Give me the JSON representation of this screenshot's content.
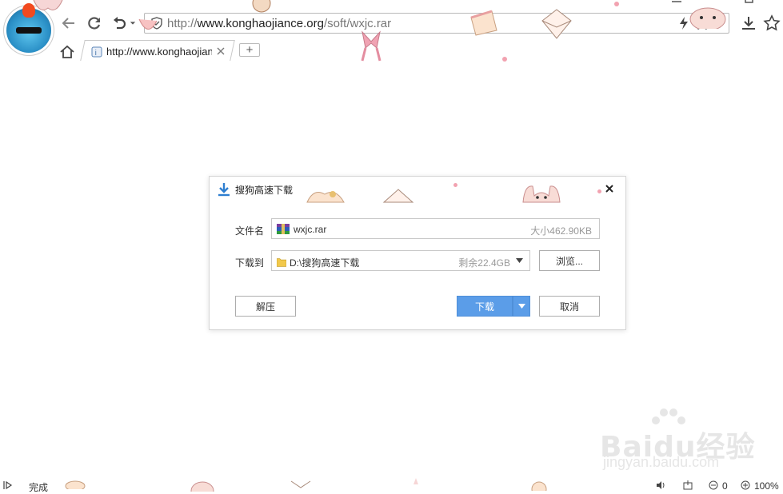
{
  "toolbar": {
    "url_prefix": "http://",
    "url_domain": "www.konghaojiance.org",
    "url_path": "/soft/wxjc.rar"
  },
  "tab": {
    "title": "http://www.konghaojiance.org/soft/wxjc.rar"
  },
  "new_tab_label": "+",
  "dialog": {
    "title": "搜狗高速下载",
    "filename_label": "文件名",
    "filename_value": "wxjc.rar",
    "filesize": "大小462.90KB",
    "saveto_label": "下载到",
    "saveto_value": "D:\\搜狗高速下载",
    "free_space": "剩余22.4GB",
    "browse_button": "浏览...",
    "extract_button": "解压",
    "download_button": "下载",
    "cancel_button": "取消"
  },
  "status": {
    "text": "完成",
    "adblock_count": "0",
    "zoom": "100%"
  },
  "watermark": {
    "logo": "Baidu经验",
    "url": "jingyan.baidu.com"
  },
  "colors": {
    "primary": "#5b9de8",
    "deco_pink": "#f2a2b0"
  }
}
